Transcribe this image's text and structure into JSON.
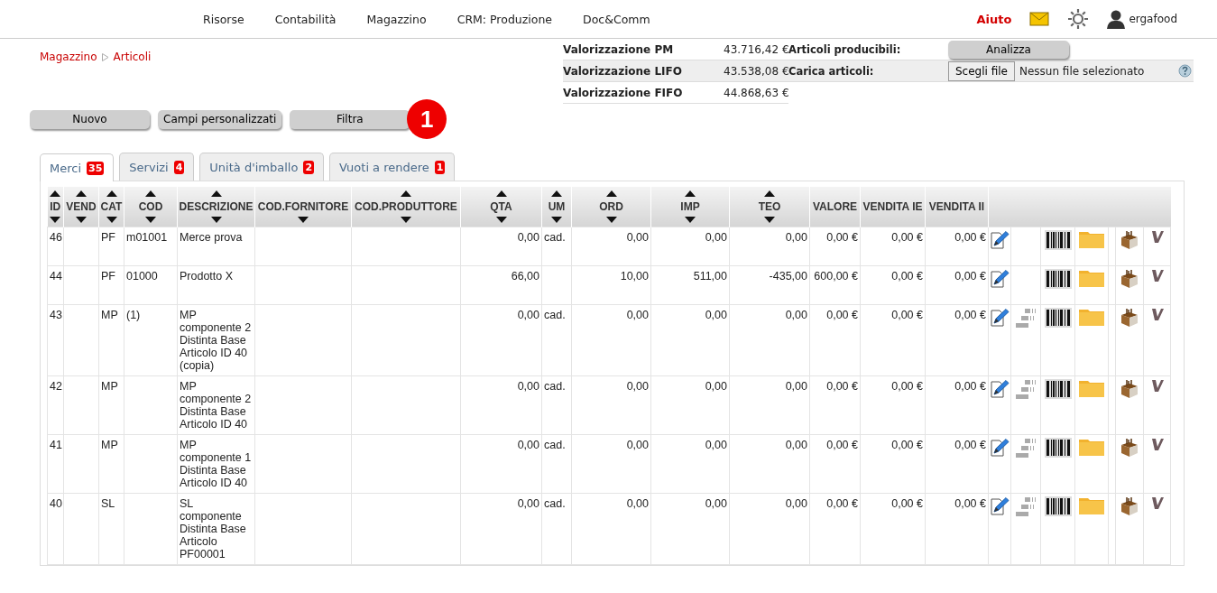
{
  "nav": {
    "items": [
      "Risorse",
      "Contabilità",
      "Magazzino",
      "CRM: Produzione",
      "Doc&Comm"
    ],
    "help": "Aiuto",
    "user": "ergafood"
  },
  "breadcrumb": [
    "Magazzino",
    "Articoli"
  ],
  "summary": {
    "rows": [
      {
        "label": "Valorizzazione PM",
        "value": "43.716,42 €",
        "label_2": "Articoli producibili:",
        "kind": "button",
        "button": "Analizza"
      },
      {
        "label": "Valorizzazione LIFO",
        "value": "43.538,08 €",
        "label_2": "Carica articoli:",
        "kind": "file",
        "button": "Scegli file",
        "file_text": "Nessun file selezionato"
      },
      {
        "label": "Valorizzazione FIFO",
        "value": "44.868,63 €",
        "kind": "plain"
      }
    ]
  },
  "actions": [
    "Nuovo",
    "Campi personalizzati",
    "Filtra"
  ],
  "step_badge": "1",
  "tabs": [
    {
      "label": "Merci",
      "count": "35",
      "selected": true
    },
    {
      "label": "Servizi",
      "count": "4",
      "selected": false
    },
    {
      "label": "Unità d'imballo",
      "count": "2",
      "selected": false
    },
    {
      "label": "Vuoti a rendere",
      "count": "1",
      "selected": false
    }
  ],
  "table": {
    "columns": [
      {
        "label": "ID",
        "kind": "sortedtext"
      },
      {
        "label": "VEND",
        "kind": "sortedtext"
      },
      {
        "label": "CAT",
        "kind": "sortedtext"
      },
      {
        "label": "COD",
        "kind": "sortedtext"
      },
      {
        "label": "DESCRIZIONE",
        "kind": "sortedtext"
      },
      {
        "label": "COD.FORNITORE",
        "kind": "downtext"
      },
      {
        "label": "COD.PRODUTTORE",
        "kind": "sortedtext"
      },
      {
        "label": "QTA",
        "kind": "sortednumber"
      },
      {
        "label": "UM",
        "kind": "sortedtext"
      },
      {
        "label": "ORD",
        "kind": "sortednumber"
      },
      {
        "label": "IMP",
        "kind": "sortednumber"
      },
      {
        "label": "TEO",
        "kind": "sortednumber"
      },
      {
        "label": "VALORE",
        "kind": "plainnumber"
      },
      {
        "label": "VENDITA IE",
        "kind": "plainnumber"
      },
      {
        "label": "VENDITA II",
        "kind": "plainnumber"
      }
    ],
    "rows": [
      {
        "cells": [
          "46",
          "",
          "PF",
          "m01001",
          "Merce prova",
          "",
          "",
          "0,00",
          "cad.",
          "0,00",
          "0,00",
          "0,00",
          "0,00 €",
          "0,00 €",
          "0,00 €"
        ],
        "has_bom": false
      },
      {
        "cells": [
          "44",
          "",
          "PF",
          "01000",
          "Prodotto X",
          "",
          "",
          "66,00",
          "",
          "10,00",
          "511,00",
          "-435,00",
          "600,00 €",
          "0,00 €",
          "0,00 €"
        ],
        "has_bom": false
      },
      {
        "cells": [
          "43",
          "",
          "MP",
          "(1)",
          "MP componente 2 Distinta Base Articolo ID 40 (copia)",
          "",
          "",
          "0,00",
          "cad.",
          "0,00",
          "0,00",
          "0,00",
          "0,00 €",
          "0,00 €",
          "0,00 €"
        ],
        "has_bom": true
      },
      {
        "cells": [
          "42",
          "",
          "MP",
          "",
          "MP componente 2 Distinta Base Articolo ID 40",
          "",
          "",
          "0,00",
          "cad.",
          "0,00",
          "0,00",
          "0,00",
          "0,00 €",
          "0,00 €",
          "0,00 €"
        ],
        "has_bom": true
      },
      {
        "cells": [
          "41",
          "",
          "MP",
          "",
          "MP componente 1 Distinta Base Articolo ID 40",
          "",
          "",
          "0,00",
          "cad.",
          "0,00",
          "0,00",
          "0,00",
          "0,00 €",
          "0,00 €",
          "0,00 €"
        ],
        "has_bom": true
      },
      {
        "cells": [
          "40",
          "",
          "SL",
          "",
          "SL componente Distinta Base Articolo PF00001",
          "",
          "",
          "0,00",
          "cad.",
          "0,00",
          "0,00",
          "0,00",
          "0,00 €",
          "0,00 €",
          "0,00 €"
        ],
        "has_bom": true
      }
    ]
  }
}
